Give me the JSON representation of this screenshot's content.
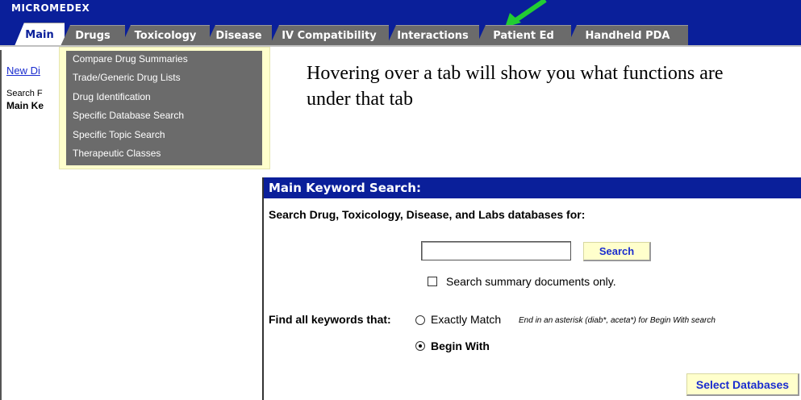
{
  "brand": "MICROMEDEX",
  "tabs": [
    {
      "label": "Main",
      "active": true
    },
    {
      "label": "Drugs"
    },
    {
      "label": "Toxicology"
    },
    {
      "label": "Disease"
    },
    {
      "label": "IV Compatibility"
    },
    {
      "label": "Interactions"
    },
    {
      "label": "Patient Ed"
    },
    {
      "label": "Handheld PDA"
    }
  ],
  "left": {
    "new_link": "New Di",
    "search_label": "Search F",
    "main_label": "Main Ke"
  },
  "dropdown": {
    "items": [
      "Compare Drug Summaries",
      "Trade/Generic Drug Lists",
      "Drug Identification",
      "Specific Database Search",
      "Specific Topic Search",
      "Therapeutic Classes"
    ]
  },
  "note": "Hovering over a tab will show you what functions are under that tab",
  "panel": {
    "header": "Main Keyword Search:",
    "subtitle": "Search Drug, Toxicology, Disease, and Labs databases for:",
    "search_value": "",
    "search_button": "Search",
    "checkbox_label": "Search summary documents only.",
    "find_label": "Find all keywords that:",
    "exact_label": "Exactly Match",
    "exact_hint": "End in an asterisk (diab*, aceta*) for Begin With search",
    "begin_label": "Begin With",
    "select_button": "Select Databases"
  },
  "colors": {
    "navy": "#0a1f9a",
    "tab_gray": "#6b6b6b",
    "button_bg": "#ffffcc",
    "arrow": "#22cc33"
  }
}
